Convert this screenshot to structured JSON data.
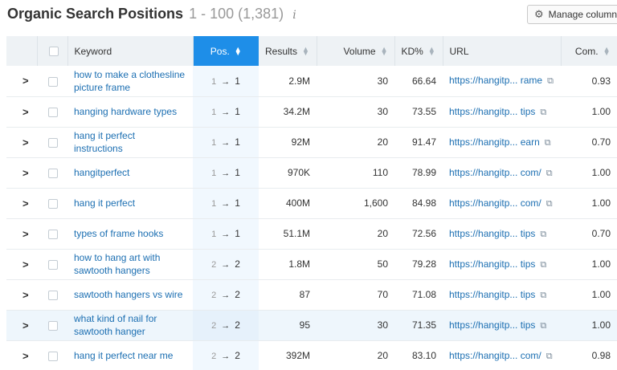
{
  "header": {
    "title": "Organic Search Positions",
    "range": "1 - 100 (1,381)",
    "info_icon": "i",
    "manage_columns_label": "Manage columns",
    "manage_icon": "gear-icon"
  },
  "columns": {
    "keyword": "Keyword",
    "pos": "Pos.",
    "results": "Results",
    "volume": "Volume",
    "kd": "KD%",
    "url": "URL",
    "com": "Com."
  },
  "rows": [
    {
      "keyword": "how to make a clothesline picture frame",
      "prev": "1",
      "cur": "1",
      "results": "2.9M",
      "volume": "30",
      "kd": "66.64",
      "url": "https://hangitp... rame",
      "com": "0.93"
    },
    {
      "keyword": "hanging hardware types",
      "prev": "1",
      "cur": "1",
      "results": "34.2M",
      "volume": "30",
      "kd": "73.55",
      "url": "https://hangitp... tips",
      "com": "1.00"
    },
    {
      "keyword": "hang it perfect instructions",
      "prev": "1",
      "cur": "1",
      "results": "92M",
      "volume": "20",
      "kd": "91.47",
      "url": "https://hangitp... earn",
      "com": "0.70"
    },
    {
      "keyword": "hangitperfect",
      "prev": "1",
      "cur": "1",
      "results": "970K",
      "volume": "110",
      "kd": "78.99",
      "url": "https://hangitp... com/",
      "com": "1.00"
    },
    {
      "keyword": "hang it perfect",
      "prev": "1",
      "cur": "1",
      "results": "400M",
      "volume": "1,600",
      "kd": "84.98",
      "url": "https://hangitp... com/",
      "com": "1.00"
    },
    {
      "keyword": "types of frame hooks",
      "prev": "1",
      "cur": "1",
      "results": "51.1M",
      "volume": "20",
      "kd": "72.56",
      "url": "https://hangitp... tips",
      "com": "0.70"
    },
    {
      "keyword": "how to hang art with sawtooth hangers",
      "prev": "2",
      "cur": "2",
      "results": "1.8M",
      "volume": "50",
      "kd": "79.28",
      "url": "https://hangitp... tips",
      "com": "1.00"
    },
    {
      "keyword": "sawtooth hangers vs wire",
      "prev": "2",
      "cur": "2",
      "results": "87",
      "volume": "70",
      "kd": "71.08",
      "url": "https://hangitp... tips",
      "com": "1.00"
    },
    {
      "keyword": "what kind of nail for sawtooth hanger",
      "prev": "2",
      "cur": "2",
      "results": "95",
      "volume": "30",
      "kd": "71.35",
      "url": "https://hangitp... tips",
      "com": "1.00"
    },
    {
      "keyword": "hang it perfect near me",
      "prev": "2",
      "cur": "2",
      "results": "392M",
      "volume": "20",
      "kd": "83.10",
      "url": "https://hangitp... com/",
      "com": "0.98"
    }
  ],
  "highlighted_row": 8,
  "colors": {
    "accent": "#1e8ee8",
    "link": "#1c6fb2",
    "header_bg": "#eef2f5"
  }
}
